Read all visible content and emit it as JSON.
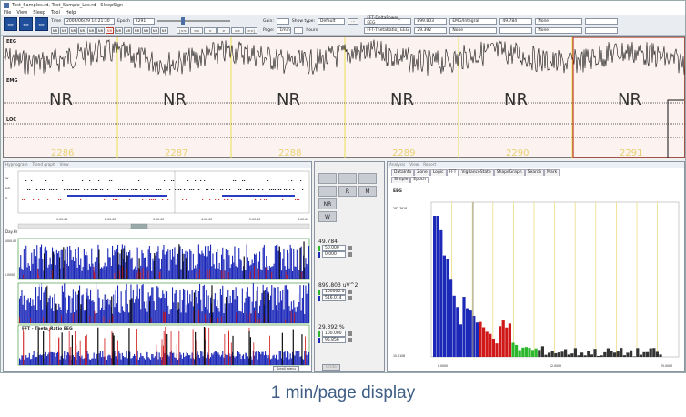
{
  "window": {
    "title": "Test_Samples.rd, Test_Sample_Loc.rd - SleepSign"
  },
  "menu": [
    "File",
    "View",
    "Sleep",
    "Tool",
    "Help"
  ],
  "toolbar": {
    "time_label": "Time",
    "time_value": "2006/06/29 14:21:30",
    "epoch_label": "Epoch",
    "epoch_value": "2291",
    "stage_buttons": [
      "NR",
      "NR",
      "NR",
      "NR",
      "NR",
      "NR",
      "NR",
      "NR",
      "NR",
      "NR",
      "NR",
      "NR",
      "NR"
    ],
    "gain_label": "Gain:",
    "page_label": "Page:",
    "page_value": "1min",
    "hours_label": "hours",
    "show_type_label": "Show type:",
    "show_type_value": "Default",
    "fft_delta_label": "FFT-DeltaPower_ EEG",
    "fft_delta_value": "899.803",
    "fft_theta_label": "FFT-ThetaRatio_ EEG",
    "fft_theta_value": "29.392",
    "emg_label": "EMG/Integral",
    "emg_value": "49.784",
    "none_a": "None",
    "none_b": "None",
    "none_c": "None",
    "none_d": "None",
    "nav": [
      "|<<",
      "<<",
      "<",
      ">",
      ">>",
      ">>|"
    ]
  },
  "eeg_panel": {
    "channels": [
      "EEG",
      "EMG",
      "LOC"
    ],
    "stages": [
      "NR",
      "NR",
      "NR",
      "NR",
      "NR",
      "NR"
    ],
    "epochs": [
      "2286",
      "2287",
      "2288",
      "2289",
      "2290",
      "2291"
    ]
  },
  "hypnogram_panel": {
    "header": [
      "Hypnogram",
      "Trend graph",
      "View"
    ],
    "y_labels": [
      "W",
      "NR",
      "R"
    ],
    "x_ticks": [
      "1:00:00",
      "2:00:00",
      "3:00:00",
      "4:00:00",
      "5:00:00",
      "6:00:00"
    ],
    "day_label": "Day.Hr",
    "traces": [
      {
        "name": "Integral",
        "value": "49.784",
        "sub1": "50.000",
        "sub2": "0.000"
      },
      {
        "name": "FFT - Delta",
        "value": "899.803 uV^2",
        "sub1": "100000.0",
        "sub2": "516.014"
      },
      {
        "name": "FFT - Theta_Ratio   EEG",
        "value": "29.392 %",
        "sub1": "100.000",
        "sub2": "95.856"
      }
    ],
    "y_axis": [
      "1000.00",
      "0.0000"
    ],
    "scroll_label": "Scroll menu",
    "stage_pad": [
      "R",
      "M",
      "NR",
      "W"
    ],
    "undo_label": "Undo"
  },
  "fft_panel": {
    "header": [
      "Analysis",
      "View",
      "Report"
    ],
    "tabs": [
      "DataInfo",
      "Zone",
      "Logic",
      "FFT",
      "VigilanceState",
      "ShapeGraph",
      "Search",
      "Mark"
    ],
    "sub_tabs": [
      "Simple",
      "Epoch"
    ],
    "channel": "EEG",
    "y_top": "282.7618",
    "y_bottom": "10.0108",
    "x_left": "0.0000",
    "x_mid": "12.0000",
    "x_right": "25.0000"
  },
  "caption": "1 min/page display",
  "colors": {
    "accent": "#1f4e9a",
    "epoch_line": "#e8e050",
    "current_epoch": "#c0392b",
    "spectrum_blue": "#1c28b8",
    "spectrum_red": "#d01818",
    "spectrum_green": "#2cb82c"
  }
}
